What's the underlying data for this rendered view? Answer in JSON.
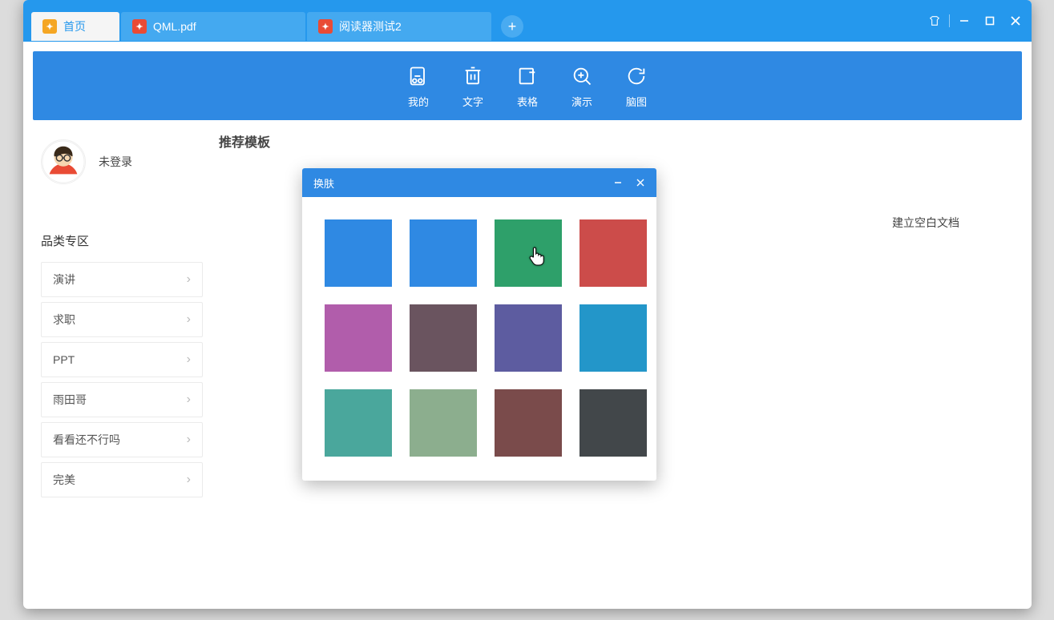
{
  "tabs": {
    "home": "首页",
    "file1": "QML.pdf",
    "file2": "阅读器测试2"
  },
  "banner": {
    "mine": "我的",
    "text": "文字",
    "table": "表格",
    "present": "演示",
    "mind": "脑图"
  },
  "user": {
    "login_text": "未登录"
  },
  "sidebar": {
    "title": "品类专区",
    "items": [
      "演讲",
      "求职",
      "PPT",
      "雨田哥",
      "看看还不行吗",
      "完美"
    ]
  },
  "section": {
    "recommend": "推荐模板"
  },
  "right": {
    "blank_doc": "建立空白文档"
  },
  "skin": {
    "title": "换肤",
    "colors": [
      "#2f89e3",
      "#2f89e3",
      "#2ea06a",
      "#cc4c4a",
      "#b15dab",
      "#6a545f",
      "#5d5ca0",
      "#2396c9",
      "#4aa79c",
      "#8cae8e",
      "#7a4b4b",
      "#42474a"
    ]
  }
}
